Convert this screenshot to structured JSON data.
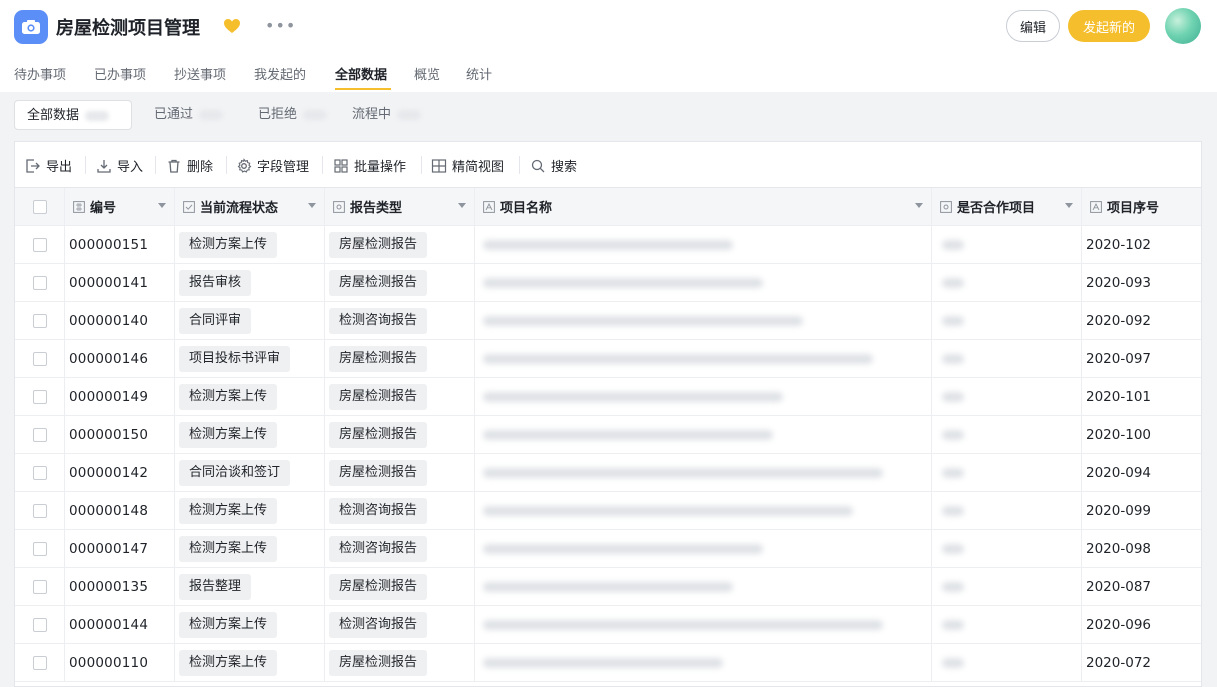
{
  "app": {
    "title": "房屋检测项目管理",
    "icon": "camera-icon",
    "favorite_icon": "heart-icon",
    "more_icon": "more-icon",
    "edit_label": "编辑",
    "new_label": "发起新的",
    "accent_color": "#f5be2c",
    "app_icon_color": "#5b8ef7"
  },
  "nav": {
    "tabs": [
      "待办事项",
      "已办事项",
      "抄送事项",
      "我发起的",
      "全部数据",
      "概览",
      "统计"
    ],
    "active": "全部数据"
  },
  "subtabs": {
    "items": [
      "全部数据",
      "已通过",
      "已拒绝",
      "流程中"
    ],
    "active": "全部数据"
  },
  "toolbar": {
    "export": "导出",
    "import": "导入",
    "delete": "删除",
    "fields": "字段管理",
    "batch": "批量操作",
    "simple_view": "精简视图",
    "search": "搜索"
  },
  "table": {
    "headers": {
      "id": "编号",
      "status": "当前流程状态",
      "report_type": "报告类型",
      "project_name": "项目名称",
      "cooperation": "是否合作项目",
      "seq": "项目序号"
    },
    "rows": [
      {
        "id": "000000151",
        "status": "检测方案上传",
        "report_type": "房屋检测报告",
        "seq": "2020-102"
      },
      {
        "id": "000000141",
        "status": "报告审核",
        "report_type": "房屋检测报告",
        "seq": "2020-093"
      },
      {
        "id": "000000140",
        "status": "合同评审",
        "report_type": "检测咨询报告",
        "seq": "2020-092"
      },
      {
        "id": "000000146",
        "status": "项目投标书评审",
        "report_type": "房屋检测报告",
        "seq": "2020-097"
      },
      {
        "id": "000000149",
        "status": "检测方案上传",
        "report_type": "房屋检测报告",
        "seq": "2020-101"
      },
      {
        "id": "000000150",
        "status": "检测方案上传",
        "report_type": "房屋检测报告",
        "seq": "2020-100"
      },
      {
        "id": "000000142",
        "status": "合同洽谈和签订",
        "report_type": "房屋检测报告",
        "seq": "2020-094"
      },
      {
        "id": "000000148",
        "status": "检测方案上传",
        "report_type": "检测咨询报告",
        "seq": "2020-099"
      },
      {
        "id": "000000147",
        "status": "检测方案上传",
        "report_type": "检测咨询报告",
        "seq": "2020-098"
      },
      {
        "id": "000000135",
        "status": "报告整理",
        "report_type": "房屋检测报告",
        "seq": "2020-087"
      },
      {
        "id": "000000144",
        "status": "检测方案上传",
        "report_type": "检测咨询报告",
        "seq": "2020-096"
      },
      {
        "id": "000000110",
        "status": "检测方案上传",
        "report_type": "房屋检测报告",
        "seq": "2020-072"
      }
    ]
  }
}
